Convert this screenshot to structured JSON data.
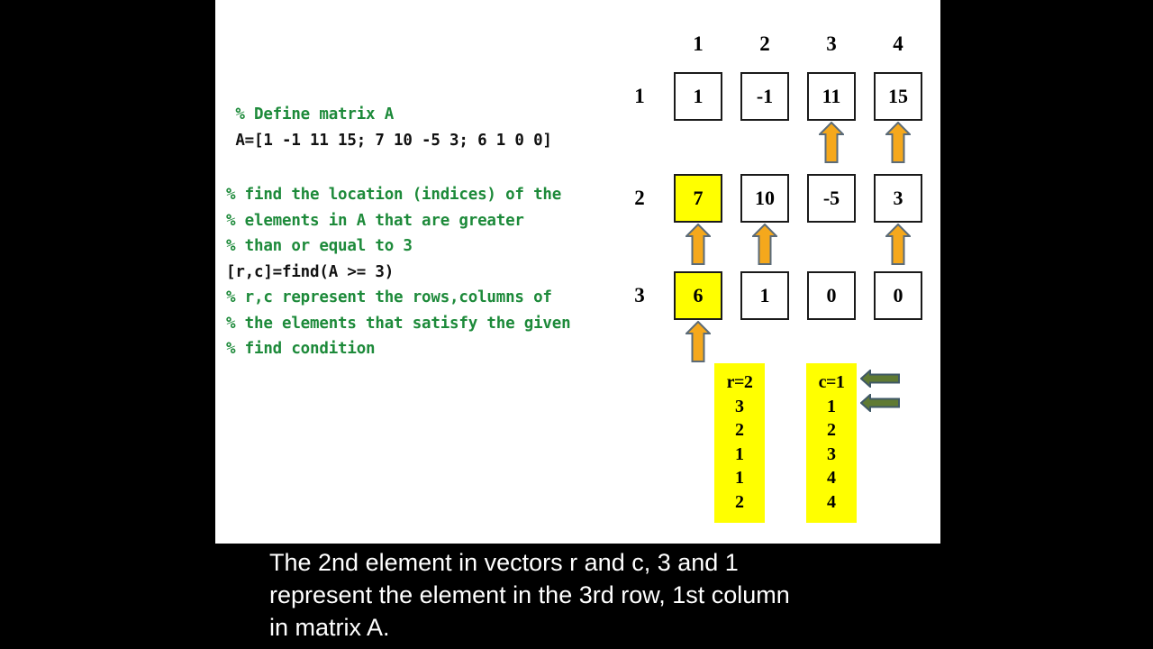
{
  "code": {
    "lines": [
      {
        "text": " % Define matrix A",
        "kind": "comment"
      },
      {
        "text": " A=[1 -1 11 15; 7 10 -5 3; 6 1 0 0]",
        "kind": "command"
      },
      {
        "text": "",
        "kind": "gap"
      },
      {
        "text": "% find the location (indices) of the",
        "kind": "comment"
      },
      {
        "text": "% elements in A that are greater",
        "kind": "comment"
      },
      {
        "text": "% than or equal to 3",
        "kind": "comment"
      },
      {
        "text": "[r,c]=find(A >= 3)",
        "kind": "command"
      },
      {
        "text": "% r,c represent the rows,columns of",
        "kind": "comment"
      },
      {
        "text": "% the elements that satisfy the given",
        "kind": "comment"
      },
      {
        "text": "% find condition",
        "kind": "comment"
      }
    ]
  },
  "matrix": {
    "column_headers": [
      "1",
      "2",
      "3",
      "4"
    ],
    "row_headers": [
      "1",
      "2",
      "3"
    ],
    "rows": [
      [
        {
          "value": "1",
          "highlighted": false,
          "arrow": false
        },
        {
          "value": "-1",
          "highlighted": false,
          "arrow": false
        },
        {
          "value": "11",
          "highlighted": false,
          "arrow": true
        },
        {
          "value": "15",
          "highlighted": false,
          "arrow": true
        }
      ],
      [
        {
          "value": "7",
          "highlighted": true,
          "arrow": true
        },
        {
          "value": "10",
          "highlighted": false,
          "arrow": true
        },
        {
          "value": "-5",
          "highlighted": false,
          "arrow": false
        },
        {
          "value": "3",
          "highlighted": false,
          "arrow": true
        }
      ],
      [
        {
          "value": "6",
          "highlighted": true,
          "arrow": true
        },
        {
          "value": "1",
          "highlighted": false,
          "arrow": false
        },
        {
          "value": "0",
          "highlighted": false,
          "arrow": false
        },
        {
          "value": "0",
          "highlighted": false,
          "arrow": false
        }
      ]
    ]
  },
  "vectors": {
    "r": {
      "label": "r=2",
      "items": [
        "3",
        "2",
        "1",
        "1",
        "2"
      ]
    },
    "c": {
      "label": "c=1",
      "items": [
        "1",
        "2",
        "3",
        "4",
        "4"
      ]
    },
    "pointer_arrows": 2
  },
  "caption": {
    "line1": "The 2nd element in vectors r and c, 3 and 1",
    "line2": "represent the element in the 3rd row, 1st column",
    "line3": "in matrix A."
  },
  "colors": {
    "comment_green": "#1d8a3a",
    "command_black": "#111111",
    "highlight_yellow": "#ffff00",
    "orange_arrow_fill": "#f5a81c",
    "orange_arrow_stroke": "#5b6b78",
    "green_arrow_fill": "#5f7a33",
    "green_arrow_stroke": "#3f5866",
    "panel_background": "#ffffff",
    "stage_background": "#000000",
    "caption_text": "#ffffff"
  }
}
